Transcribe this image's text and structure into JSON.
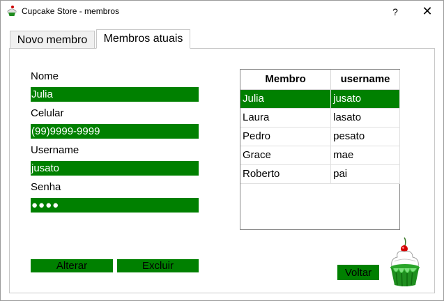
{
  "window": {
    "title": "Cupcake Store - membros",
    "help_glyph": "?",
    "close_glyph": "✕"
  },
  "tabs": [
    {
      "label": "Novo membro",
      "active": false
    },
    {
      "label": "Membros atuais",
      "active": true
    }
  ],
  "form": {
    "nome_label": "Nome",
    "nome_value": "Julia",
    "celular_label": "Celular",
    "celular_value": "(99)9999-9999",
    "username_label": "Username",
    "username_value": "jusato",
    "senha_label": "Senha",
    "senha_value": "●●●●"
  },
  "buttons": {
    "alterar": "Alterar",
    "excluir": "Excluir",
    "voltar": "Voltar"
  },
  "table": {
    "headers": [
      "Membro",
      "username"
    ],
    "rows": [
      [
        "Julia",
        "jusato"
      ],
      [
        "Laura",
        "lasato"
      ],
      [
        "Pedro",
        "pesato"
      ],
      [
        "Grace",
        "mae"
      ],
      [
        "Roberto",
        "pai"
      ]
    ],
    "selected_row": 0
  },
  "colors": {
    "accent": "#008000"
  },
  "icons": {
    "app": "cupcake-icon",
    "logo": "cupcake-logo"
  }
}
